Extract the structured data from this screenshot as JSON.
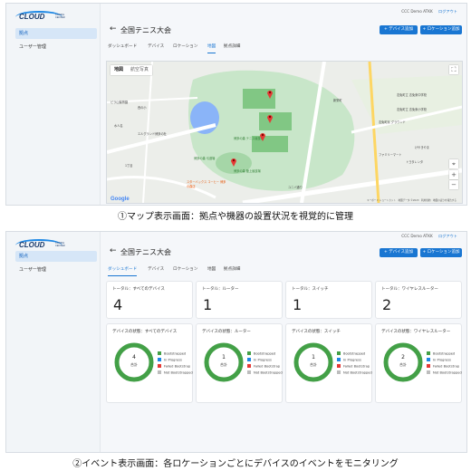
{
  "logo": {
    "main": "CLOUD",
    "sub": "CONFIG CENTER"
  },
  "header": {
    "user": "CCC Demo ATKK",
    "logout": "ログアウト"
  },
  "sidebar": {
    "items": [
      {
        "label": "拠点"
      },
      {
        "label": "ユーザー管理"
      }
    ]
  },
  "page": {
    "back": "←",
    "title": "全国テニス大会"
  },
  "buttons": {
    "add_device": "+ デバイス追加",
    "add_location": "+ ロケーション追加"
  },
  "tabs": [
    "ダッシュボード",
    "デバイス",
    "ロケーション",
    "地図",
    "拠点詳細"
  ],
  "map": {
    "map_type": [
      "地図",
      "航空写真"
    ],
    "labels": [
      "ピラ山保育園",
      "博多の森 テニス競技場",
      "博多の森 陸上競技場",
      "博多の森 弓道場",
      "スターバックス コーヒー 博多の森店",
      "ユニバ通り",
      "エルグランド博多の杜",
      "志免町立 志免東中学校",
      "志免町立 志免東小学校",
      "志免町民 グラウンド",
      "1丁目",
      "西の小",
      "水人名",
      "新栄町",
      "けやきやま",
      "トヨタレンタ",
      "ファミリーマート"
    ],
    "controls": {
      "fullscreen": "⛶",
      "locate": "⌖",
      "zoom_in": "+",
      "zoom_out": "−"
    },
    "google": "Google",
    "attribution": "キーボード ショートカット　地図データ ©2023　利用規約　地図の誤りを報告する",
    "pin_color": "#e53935"
  },
  "captions": {
    "top": "①マップ表示画面：拠点や機器の設置状況を視覚的に管理",
    "bottom": "②イベント表示画面：各ロケーションごとにデバイスのイベントをモニタリング"
  },
  "dashboard": {
    "totals": [
      {
        "label": "トータル：すべてのデバイス",
        "value": "4"
      },
      {
        "label": "トータル：ルーター",
        "value": "1"
      },
      {
        "label": "トータル：スイッチ",
        "value": "1"
      },
      {
        "label": "トータル：ワイヤレスルーター",
        "value": "2"
      }
    ],
    "status": [
      {
        "label": "デバイスの状態：すべてのデバイス",
        "value": "4",
        "sub": "合計"
      },
      {
        "label": "デバイスの状態：ルーター",
        "value": "1",
        "sub": "合計"
      },
      {
        "label": "デバイスの状態：スイッチ",
        "value": "1",
        "sub": "合計"
      },
      {
        "label": "デバイスの状態：ワイヤレスルーター",
        "value": "2",
        "sub": "合計"
      }
    ],
    "legend": [
      {
        "label": "Bootstrapped",
        "color": "#43a047"
      },
      {
        "label": "In Progress",
        "color": "#1e88e5"
      },
      {
        "label": "Failed Bootstrap",
        "color": "#e53935"
      },
      {
        "label": "Not Bootstrapped",
        "color": "#bdbdbd"
      }
    ]
  }
}
